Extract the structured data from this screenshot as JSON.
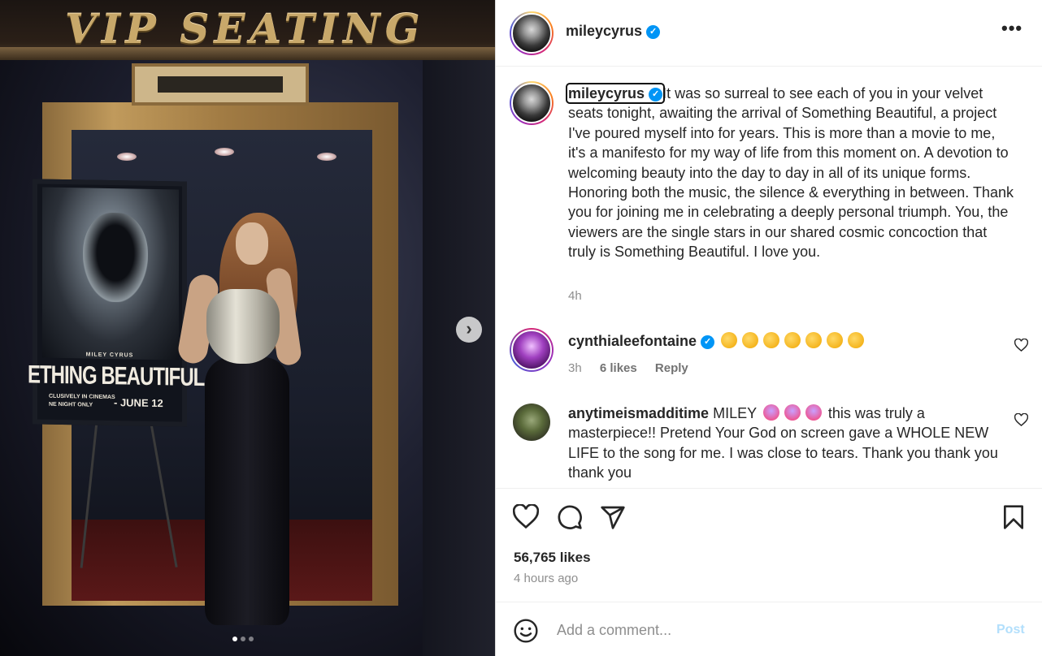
{
  "photo": {
    "sign_text": "VIP SEATING",
    "poster": {
      "artist": "MILEY CYRUS",
      "title": "ETHING BEAUTIFUL",
      "line1": "CLUSIVELY IN CINEMAS",
      "line2": "NE NIGHT ONLY",
      "date": "- JUNE 12"
    },
    "next_icon": "chevron-right-icon",
    "carousel_dots": 3,
    "active_dot": 0
  },
  "header": {
    "username": "mileycyrus",
    "verified_icon": "verified-badge-icon",
    "more_icon": "more-horizontal-icon",
    "more_label": "•••"
  },
  "caption": {
    "username": "mileycyrus",
    "text": "It was so surreal to see each of you in your velvet seats tonight, awaiting the arrival of Something Beautiful, a project I've poured myself into for years. This is more than a movie to me, it's a manifesto for my way of life from this moment on. A devotion to welcoming beauty into the day to day in all of its unique forms. Honoring both the music, the silence & everything in between. Thank you for joining me in celebrating a deeply personal triumph. You, the viewers are the single stars in our shared cosmic concoction that truly is Something Beautiful. I love you.",
    "time": "4h"
  },
  "comments": [
    {
      "username": "cynthialeefontaine",
      "verified": true,
      "text_emojis": "clapping-hands-emoji x7",
      "time": "3h",
      "likes": "6 likes",
      "reply": "Reply"
    },
    {
      "username": "anytimeismadditime",
      "text_before": "MILEY",
      "emojis": "loudly-crying-face-emoji x3",
      "text_after": "this was truly a masterpiece!! Pretend Your God on screen gave a WHOLE NEW LIFE to the song for me. I was close to tears. Thank you thank you thank you"
    }
  ],
  "actions": {
    "like_icon": "heart-icon",
    "comment_icon": "comment-icon",
    "share_icon": "send-icon",
    "save_icon": "bookmark-icon"
  },
  "stats": {
    "likes": "56,765 likes",
    "time": "4 hours ago"
  },
  "composer": {
    "emoji_icon": "smiley-icon",
    "placeholder": "Add a comment...",
    "post_label": "Post"
  },
  "colors": {
    "verified": "#0095f6",
    "post_disabled": "#b2dffc",
    "meta_text": "#8e8e8e"
  }
}
